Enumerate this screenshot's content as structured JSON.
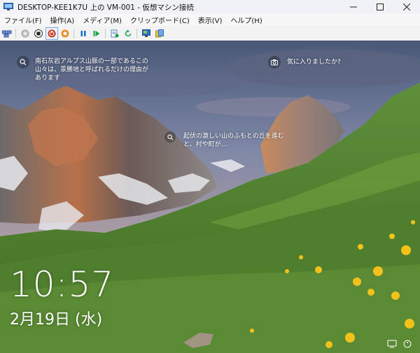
{
  "window": {
    "title": "DESKTOP-KEE1K7U 上の VM-001 - 仮想マシン接続",
    "controls": [
      "minimize-icon",
      "maximize-icon",
      "close-icon"
    ]
  },
  "menu": {
    "items": [
      "ファイル(F)",
      "操作(A)",
      "メディア(M)",
      "クリップボード(C)",
      "表示(V)",
      "ヘルプ(H)"
    ]
  },
  "toolbar": {
    "buttons": [
      "ctrl-alt-del",
      "start",
      "turn-off",
      "shut-down",
      "save",
      "pause",
      "resume",
      "checkpoint",
      "revert",
      "enhanced-session",
      "share"
    ]
  },
  "lockscreen": {
    "spotlight_text": "南石灰岩アルプス山脈の一部であるこの山々は、景勝地と呼ばれるだけの理由があります",
    "like_text": "気に入りましたか?",
    "hotspot_text": "起伏の激しい山のふもとの丘を進むと、村や町が…",
    "time": "10:57",
    "date": "2月19日 (水)"
  },
  "colors": {
    "stop_red": "#d13438",
    "shutdown_red": "#c42b1c",
    "save_orange": "#e8912d",
    "pause_blue": "#1a6fd8",
    "play_green": "#16a34a"
  }
}
